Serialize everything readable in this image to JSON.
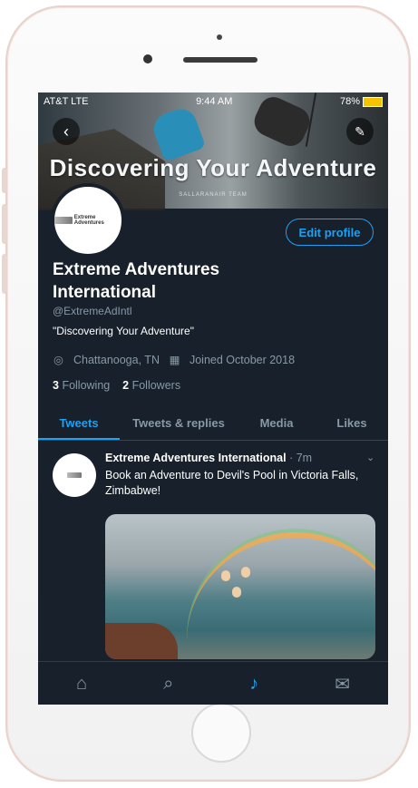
{
  "status_bar": {
    "carrier": "AT&T  LTE",
    "time": "9:44 AM",
    "battery": "78%"
  },
  "banner": {
    "title": "Discovering Your Adventure",
    "subtitle": "SALLARANAIR TEAM"
  },
  "profile": {
    "edit_label": "Edit profile",
    "name": "Extreme Adventures International",
    "handle": "@ExtremeAdIntl",
    "bio": "\"Discovering Your Adventure\"",
    "location": "Chattanooga, TN",
    "joined": "Joined October 2018",
    "following_count": "3",
    "following_label": "Following",
    "followers_count": "2",
    "followers_label": "Followers"
  },
  "tabs": [
    {
      "label": "Tweets"
    },
    {
      "label": "Tweets & replies"
    },
    {
      "label": "Media"
    },
    {
      "label": "Likes"
    }
  ],
  "tweet": {
    "author": "Extreme Adventures International",
    "time": "· 7m",
    "text": "Book an Adventure to Devil's Pool in Victoria Falls, Zimbabwe!"
  },
  "logo_text": "Extreme Adventures",
  "colors": {
    "accent": "#1da1f2",
    "background": "#17202b",
    "muted": "#8899a6"
  },
  "icons": {
    "back": "chevron-left-icon",
    "compose": "compose-icon",
    "location": "location-pin-icon",
    "calendar": "calendar-icon",
    "nav": [
      "home-icon",
      "search-icon",
      "notifications-bell-icon",
      "messages-mail-icon"
    ]
  }
}
